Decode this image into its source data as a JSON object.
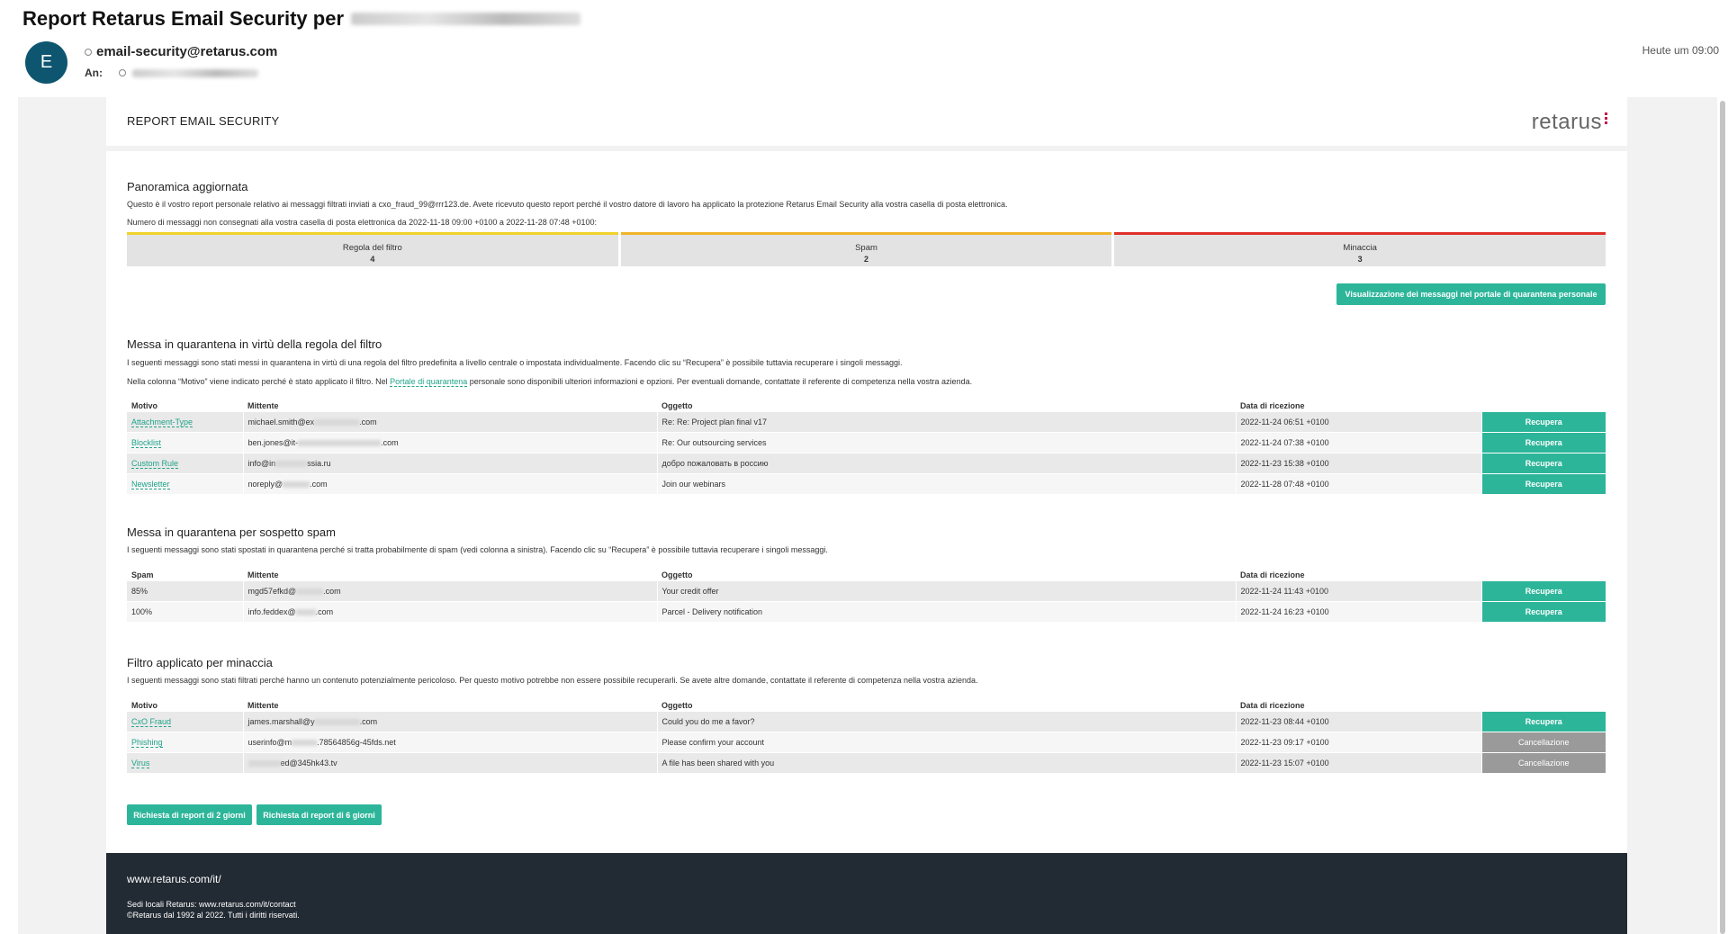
{
  "mail": {
    "subject": "Report Retarus Email Security per",
    "avatar_letter": "E",
    "from": "email-security@retarus.com",
    "to_label": "An:",
    "time": "Heute um 09:00"
  },
  "report": {
    "header_title": "REPORT EMAIL SECURITY",
    "logo_text": "retarus",
    "overview": {
      "title": "Panoramica aggiornata",
      "line1": "Questo è il vostro report personale relativo ai messaggi filtrati inviati a cxo_fraud_99@rrr123.de. Avete ricevuto questo report perché il vostro datore di lavoro ha applicato la protezione Retarus Email Security alla vostra casella di posta elettronica.",
      "line2": "Numero di messaggi non consegnati alla vostra casella di posta elettronica da 2022-11-18 09:00 +0100 a 2022-11-28 07:48 +0100:"
    },
    "stats": [
      {
        "label": "Regola del filtro",
        "count": "4",
        "color": "#f0d22b"
      },
      {
        "label": "Spam",
        "count": "2",
        "color": "#f0b42b"
      },
      {
        "label": "Minaccia",
        "count": "3",
        "color": "#e0302a"
      }
    ],
    "portal_button": "Visualizzazione dei messaggi nel portale di quarantena personale",
    "filter_section": {
      "title": "Messa in quarantena in virtù della regola del filtro",
      "line1": "I seguenti messaggi sono stati messi in quarantena in virtù di una regola del filtro predefinita a livello centrale o impostata individualmente. Facendo clic su “Recupera” è possibile tuttavia recuperare i singoli messaggi.",
      "line2_pre": "Nella colonna “Motivo” viene indicato perché è stato applicato il filtro. Nel",
      "line2_link": "Portale di quarantena",
      "line2_post": "personale sono disponibili ulteriori informazioni e opzioni. Per eventuali domande, contattate il referente di competenza nella vostra azienda.",
      "headers": [
        "Motivo",
        "Mittente",
        "Oggetto",
        "Data di ricezione"
      ],
      "rows": [
        {
          "reason": "Attachment-Type",
          "sender_pre": "michael.smith@ex",
          "sender_post": ".com",
          "subject": "Re: Re: Project plan final v17",
          "date": "2022-11-24 06:51 +0100",
          "action": "Recupera"
        },
        {
          "reason": "Blocklist",
          "sender_pre": "ben.jones@it-",
          "sender_post": ".com",
          "subject": "Re: Our outsourcing services",
          "date": "2022-11-24 07:38 +0100",
          "action": "Recupera"
        },
        {
          "reason": "Custom Rule",
          "sender_pre": "info@in",
          "sender_post": "ssia.ru",
          "subject": "добро пожаловать в россию",
          "date": "2022-11-23 15:38 +0100",
          "action": "Recupera"
        },
        {
          "reason": "Newsletter",
          "sender_pre": "noreply@",
          "sender_post": ".com",
          "subject": "Join our webinars",
          "date": "2022-11-28 07:48 +0100",
          "action": "Recupera"
        }
      ]
    },
    "spam_section": {
      "title": "Messa in quarantena per sospetto spam",
      "line1": "I seguenti messaggi sono stati spostati in quarantena perché si tratta probabilmente di spam (vedi colonna a sinistra). Facendo clic su “Recupera” è possibile tuttavia recuperare i singoli messaggi.",
      "headers": [
        "Spam",
        "Mittente",
        "Oggetto",
        "Data di ricezione"
      ],
      "rows": [
        {
          "reason": "85%",
          "sender_pre": "mgd57efkd@",
          "sender_post": ".com",
          "subject": "Your credit offer",
          "date": "2022-11-24 11:43 +0100",
          "action": "Recupera"
        },
        {
          "reason": "100%",
          "sender_pre": "info.feddex@",
          "sender_post": ".com",
          "subject": "Parcel - Delivery notification",
          "date": "2022-11-24 16:23 +0100",
          "action": "Recupera"
        }
      ]
    },
    "threat_section": {
      "title": "Filtro applicato per minaccia",
      "line1": "I seguenti messaggi sono stati filtrati perché hanno un contenuto potenzialmente pericoloso. Per questo motivo potrebbe non essere possibile recuperarli. Se avete altre domande, contattate il referente di competenza nella vostra azienda.",
      "headers": [
        "Motivo",
        "Mittente",
        "Oggetto",
        "Data di ricezione"
      ],
      "rows": [
        {
          "reason": "CxO Fraud",
          "sender_pre": "james.marshall@y",
          "sender_post": ".com",
          "subject": "Could you do me a favor?",
          "date": "2022-11-23 08:44 +0100",
          "action": "Recupera"
        },
        {
          "reason": "Phishing",
          "sender_pre": "userinfo@m",
          "sender_post": ".78564856g-45fds.net",
          "subject": "Please confirm your account",
          "date": "2022-11-23 09:17 +0100",
          "action": "Cancellazione"
        },
        {
          "reason": "Virus",
          "sender_pre": "",
          "sender_post": "ed@345hk43.tv",
          "subject": "A file has been shared with you",
          "date": "2022-11-23 15:07 +0100",
          "action": "Cancellazione"
        }
      ]
    },
    "report_buttons": [
      "Richiesta di report di 2 giorni",
      "Richiesta di report di 6 giorni"
    ],
    "footer": {
      "url": "www.retarus.com/it/",
      "line1": "Sedi locali Retarus: www.retarus.com/it/contact",
      "line2": "©Retarus dal 1992 al 2022. Tutti i diritti riservati."
    }
  }
}
